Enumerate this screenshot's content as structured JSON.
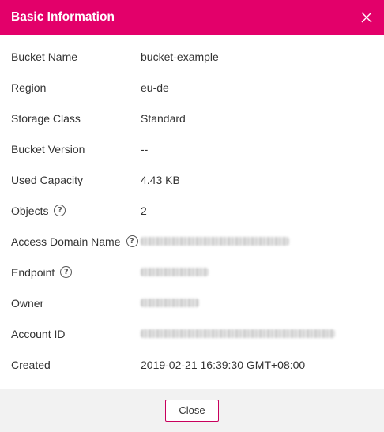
{
  "dialog": {
    "title": "Basic Information",
    "close_button_label": "Close",
    "accent_color": "#e3006a"
  },
  "fields": [
    {
      "label": "Bucket Name",
      "value": "bucket-example"
    },
    {
      "label": "Region",
      "value": "eu-de"
    },
    {
      "label": "Storage Class",
      "value": "Standard"
    },
    {
      "label": "Bucket Version",
      "value": "--"
    },
    {
      "label": "Used Capacity",
      "value": "4.43 KB"
    },
    {
      "label": "Objects",
      "value": "2",
      "help": "?"
    },
    {
      "label": "Access Domain Name",
      "help": "?"
    },
    {
      "label": "Endpoint",
      "help": "?"
    },
    {
      "label": "Owner"
    },
    {
      "label": "Account ID"
    },
    {
      "label": "Created",
      "value": "2019-02-21 16:39:30 GMT+08:00"
    }
  ]
}
